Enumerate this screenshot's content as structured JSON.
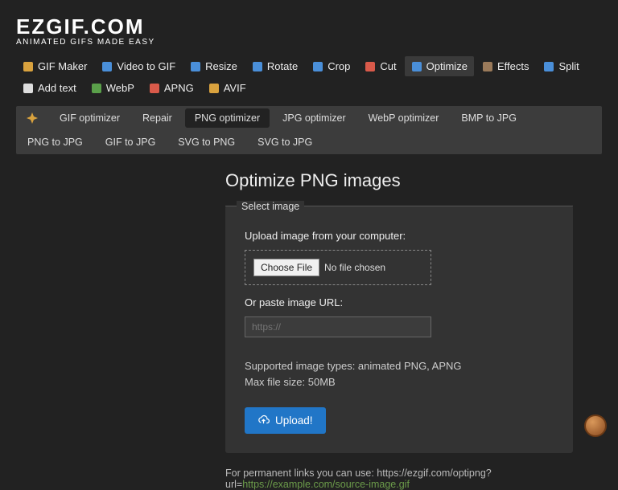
{
  "logo": {
    "main": "EZGIF.COM",
    "sub": "ANIMATED GIFS MADE EASY"
  },
  "nav": [
    {
      "label": "GIF Maker",
      "icon": "gif-maker-icon",
      "color": "#d9a23e"
    },
    {
      "label": "Video to GIF",
      "icon": "video-icon",
      "color": "#4a8fd9"
    },
    {
      "label": "Resize",
      "icon": "resize-icon",
      "color": "#4a8fd9"
    },
    {
      "label": "Rotate",
      "icon": "rotate-icon",
      "color": "#4a8fd9"
    },
    {
      "label": "Crop",
      "icon": "crop-icon",
      "color": "#4a8fd9"
    },
    {
      "label": "Cut",
      "icon": "cut-icon",
      "color": "#d95a4a"
    },
    {
      "label": "Optimize",
      "icon": "optimize-icon",
      "color": "#4a8fd9",
      "active": true
    },
    {
      "label": "Effects",
      "icon": "effects-icon",
      "color": "#9a7a5a"
    },
    {
      "label": "Split",
      "icon": "split-icon",
      "color": "#4a8fd9"
    },
    {
      "label": "Add text",
      "icon": "text-icon",
      "color": "#ddd"
    },
    {
      "label": "WebP",
      "icon": "webp-icon",
      "color": "#5aa04a"
    },
    {
      "label": "APNG",
      "icon": "apng-icon",
      "color": "#d95a4a"
    },
    {
      "label": "AVIF",
      "icon": "avif-icon",
      "color": "#d9a23e"
    }
  ],
  "subnav": [
    {
      "label": "",
      "icon_only": true
    },
    {
      "label": "GIF optimizer"
    },
    {
      "label": "Repair"
    },
    {
      "label": "PNG optimizer",
      "active": true
    },
    {
      "label": "JPG optimizer"
    },
    {
      "label": "WebP optimizer"
    },
    {
      "label": "BMP to JPG"
    },
    {
      "label": "PNG to JPG"
    },
    {
      "label": "GIF to JPG"
    },
    {
      "label": "SVG to PNG"
    },
    {
      "label": "SVG to JPG"
    }
  ],
  "page": {
    "title": "Optimize PNG images",
    "fieldset": "Select image",
    "upload_label": "Upload image from your computer:",
    "choose_file": "Choose File",
    "no_file": "No file chosen",
    "url_label": "Or paste image URL:",
    "url_placeholder": "https://",
    "supported": "Supported image types: animated PNG, APNG",
    "maxsize": "Max file size: 50MB",
    "upload_btn": "Upload!",
    "footer_prefix": "For permanent links you can use: https://ezgif.com/optipng?url=",
    "footer_link": "https://example.com/source-image.gif"
  }
}
